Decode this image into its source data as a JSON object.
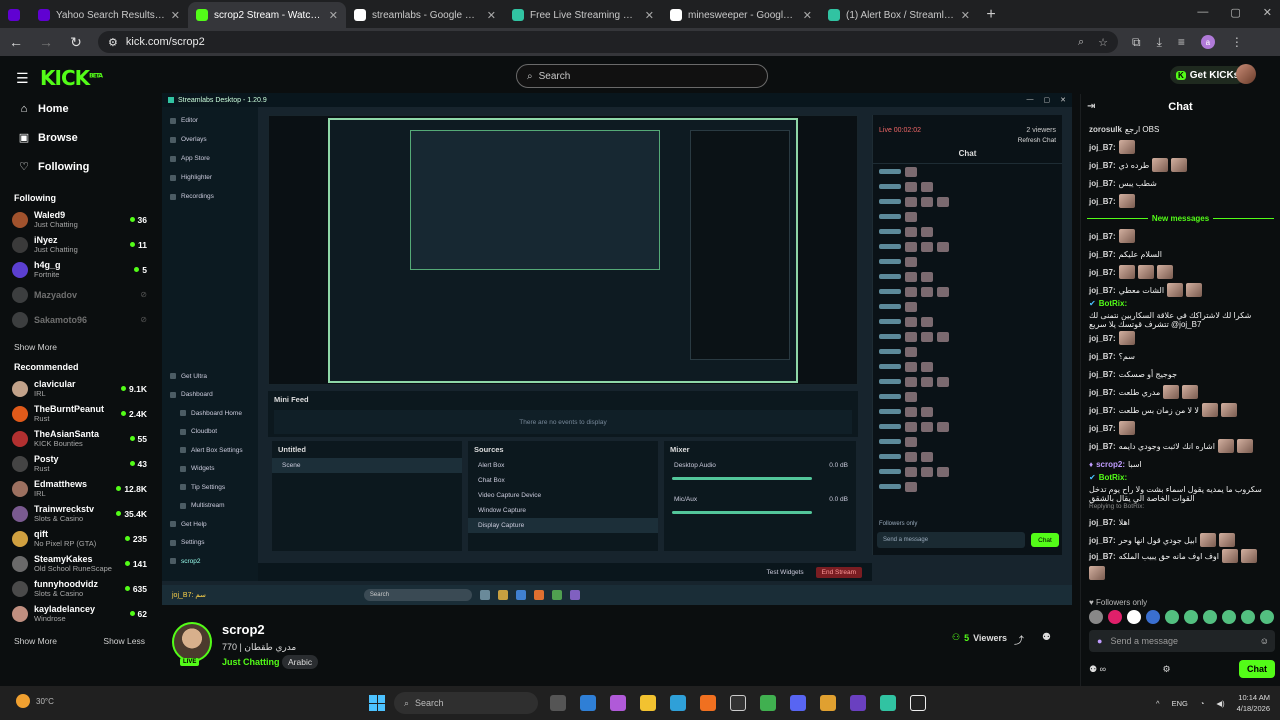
{
  "browser": {
    "tabs": [
      {
        "title": "Yahoo Search Results - قوقل",
        "color": "#6001d2",
        "active": false
      },
      {
        "title": "scrop2 Stream - Watch Live on",
        "color": "#53fc18",
        "active": true
      },
      {
        "title": "streamlabs - Google Search",
        "color": "#ffffff",
        "active": false
      },
      {
        "title": "Free Live Streaming & Recordin",
        "color": "#31c3a2",
        "active": false
      },
      {
        "title": "minesweeper - Google Search",
        "color": "#ffffff",
        "active": false
      },
      {
        "title": "(1) Alert Box / Streamlabs",
        "color": "#31c3a2",
        "active": false
      }
    ],
    "url": "kick.com/scrop2",
    "profile_initial": "a"
  },
  "kick": {
    "search_placeholder": "Search",
    "get_kicks": "Get KICKs",
    "nav": [
      {
        "label": "Home",
        "icon": "home-icon",
        "glyph": "⌂"
      },
      {
        "label": "Browse",
        "icon": "browse-icon",
        "glyph": "▣"
      },
      {
        "label": "Following",
        "icon": "heart-icon",
        "glyph": "♡"
      }
    ],
    "following_title": "Following",
    "following": [
      {
        "name": "Waled9",
        "cat": "Just Chatting",
        "viewers": "36",
        "color": "#a0522d",
        "off": false
      },
      {
        "name": "iNyez",
        "cat": "Just Chatting",
        "viewers": "11",
        "color": "#3a3a3a",
        "off": false
      },
      {
        "name": "h4g_g",
        "cat": "Fortnite",
        "viewers": "5",
        "color": "#5b3fd0",
        "off": false
      },
      {
        "name": "Mazyadov",
        "cat": "",
        "viewers": "",
        "color": "#888",
        "off": true
      },
      {
        "name": "Sakamoto96",
        "cat": "",
        "viewers": "",
        "color": "#888",
        "off": true
      }
    ],
    "show_more": "Show More",
    "recommended_title": "Recommended",
    "recommended": [
      {
        "name": "clavicular",
        "cat": "IRL",
        "viewers": "9.1K",
        "color": "#c2a28a"
      },
      {
        "name": "TheBurntPeanut",
        "cat": "Rust",
        "viewers": "2.4K",
        "color": "#e05a1a"
      },
      {
        "name": "TheAsianSanta",
        "cat": "KICK Bounties",
        "viewers": "55",
        "color": "#b23030"
      },
      {
        "name": "Posty",
        "cat": "Rust",
        "viewers": "43",
        "color": "#444"
      },
      {
        "name": "Edmatthews",
        "cat": "IRL",
        "viewers": "12.8K",
        "color": "#9c7060"
      },
      {
        "name": "Trainwreckstv",
        "cat": "Slots & Casino",
        "viewers": "35.4K",
        "color": "#7a5a90"
      },
      {
        "name": "qift",
        "cat": "No Pixel RP (GTA)",
        "viewers": "235",
        "color": "#d0a040"
      },
      {
        "name": "SteamyKakes",
        "cat": "Old School RuneScape",
        "viewers": "141",
        "color": "#6a6a6a"
      },
      {
        "name": "funnyhoodvidz",
        "cat": "Slots & Casino",
        "viewers": "635",
        "color": "#4a4a4a"
      },
      {
        "name": "kayladelancey",
        "cat": "Windrose",
        "viewers": "62",
        "color": "#c08f80"
      }
    ],
    "show_more2": "Show More",
    "show_less": "Show Less"
  },
  "stream_inner": {
    "app_title": "Streamlabs Desktop - 1.20.9",
    "side": [
      "Editor",
      "Overlays",
      "App Store",
      "Highlighter",
      "Recordings"
    ],
    "side_bottom": [
      "Get Ultra",
      "Dashboard",
      "Dashboard Home",
      "Cloudbot",
      "Alert Box Settings",
      "Widgets",
      "Tip Settings",
      "Multistream",
      "Get Help",
      "Settings",
      "scrop2"
    ],
    "chat_live": "Live 00:02:02",
    "chat_viewers": "2 viewers",
    "refresh_chat": "Refresh Chat",
    "chat_title": "Chat",
    "followers_only": "Followers only",
    "send_placeholder": "Send a message",
    "chat_btn": "Chat",
    "mini_feed": "Mini Feed",
    "no_events": "There are no events to display",
    "scenes_title": "Untitled",
    "scene": "Scene",
    "sources_title": "Sources",
    "sources": [
      "Alert Box",
      "Chat Box",
      "Video Capture Device",
      "Window Capture",
      "Display Capture"
    ],
    "mixer_title": "Mixer",
    "desktop_audio": "Desktop Audio",
    "mic_aux": "Mic/Aux",
    "db": "0.0 dB",
    "test_widgets": "Test Widgets",
    "end_stream": "End Stream",
    "task_search": "Search",
    "ticker": "joj_B7: سم"
  },
  "channel": {
    "name": "scrop2",
    "live": "LIVE",
    "title": "مدري طقطان | 770",
    "category": "Just Chatting",
    "tag": "Arabic",
    "viewers_count": "5",
    "viewers_label": "Viewers"
  },
  "chat": {
    "title": "Chat",
    "new_messages": "New messages",
    "messages": [
      {
        "user": "zorosulk",
        "text": "ارجع OBS",
        "emotes": 0,
        "type": "normal"
      },
      {
        "user": "joj_B7:",
        "text": "",
        "emotes": 1,
        "type": "normal"
      },
      {
        "user": "joj_B7:",
        "text": "طرده ذي",
        "emotes": 2,
        "type": "normal"
      },
      {
        "user": "joj_B7:",
        "text": "شطب يبس",
        "emotes": 0,
        "type": "normal"
      },
      {
        "user": "joj_B7:",
        "text": "",
        "emotes": 1,
        "type": "normal"
      },
      {
        "user": "NEW",
        "text": "",
        "emotes": 0,
        "type": "sep"
      },
      {
        "user": "joj_B7:",
        "text": "",
        "emotes": 1,
        "type": "normal"
      },
      {
        "user": "joj_B7:",
        "text": "السلام عليكم",
        "emotes": 0,
        "type": "normal"
      },
      {
        "user": "joj_B7:",
        "text": "",
        "emotes": 3,
        "type": "normal"
      },
      {
        "user": "joj_B7:",
        "text": "الشات معطي",
        "emotes": 2,
        "type": "normal"
      },
      {
        "user": "BotRix:",
        "text": "شكرا لك لاشتراكك في علاقة السكاربين نتمنى لك تتشرف قوتسك يلا سريع @joj_B7",
        "emotes": 0,
        "type": "bot"
      },
      {
        "user": "joj_B7:",
        "text": "",
        "emotes": 1,
        "type": "normal"
      },
      {
        "user": "joj_B7:",
        "text": "سم؟",
        "emotes": 0,
        "type": "normal"
      },
      {
        "user": "joj_B7:",
        "text": "جوجيج أو صسكت",
        "emotes": 0,
        "type": "normal"
      },
      {
        "user": "joj_B7:",
        "text": "مدري طلعت",
        "emotes": 2,
        "type": "normal"
      },
      {
        "user": "joj_B7:",
        "text": "لا لا من زمان بس طلعت",
        "emotes": 2,
        "type": "normal"
      },
      {
        "user": "joj_B7:",
        "text": "",
        "emotes": 1,
        "type": "normal"
      },
      {
        "user": "joj_B7:",
        "text": "اشاره انك لاثبت وجودي دايمه",
        "emotes": 2,
        "type": "normal"
      },
      {
        "user": "scrop2:",
        "text": "اسبا",
        "emotes": 0,
        "type": "streamer"
      },
      {
        "user": "BotRix:",
        "text": "سكروب ما يمديه يقول اسماء بشت ولا راح يوم تدخل القوات الخاصة الي يقال بالشقق",
        "emotes": 0,
        "type": "bot"
      },
      {
        "user": "joj_B7:",
        "text": "اهلا",
        "emotes": 0,
        "type": "normal"
      },
      {
        "user": "joj_B7:",
        "text": "ابيل جودي قول انها وحر",
        "emotes": 2,
        "type": "normal"
      },
      {
        "user": "joj_B7:",
        "text": "اوف اوف مانه حق يبيب الملكه",
        "emotes": 3,
        "type": "normal"
      }
    ],
    "reply_note": "Replying to BotRix:",
    "followers_only": "Followers only",
    "send_placeholder": "Send a message",
    "send_button": "Chat"
  },
  "taskbar": {
    "temp": "30°C",
    "search": "Search",
    "lang": "ENG",
    "time": "10:14 AM",
    "date": "4/18/2026"
  }
}
